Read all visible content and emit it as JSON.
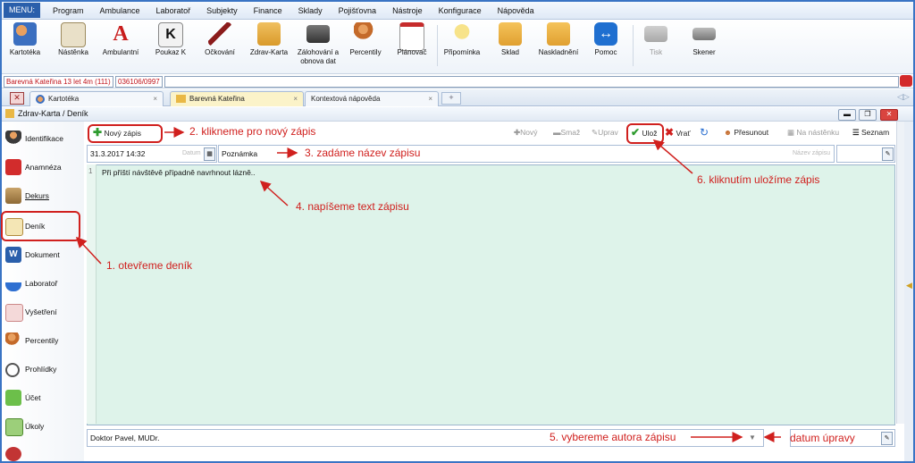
{
  "menu": {
    "label": "MENU:",
    "items": [
      "Program",
      "Ambulance",
      "Laboratoř",
      "Subjekty",
      "Finance",
      "Sklady",
      "Pojišťovna",
      "Nástroje",
      "Konfigurace",
      "Nápověda"
    ]
  },
  "toolbar": {
    "items": [
      {
        "label": "Kartotéka",
        "icon": "people-icon"
      },
      {
        "label": "Nástěnka",
        "icon": "clipboard-icon"
      },
      {
        "label": "Ambulantní",
        "icon": "letter-a-icon"
      },
      {
        "label": "Poukaz K",
        "icon": "letter-k-icon"
      },
      {
        "label": "Očkování",
        "icon": "syringe-icon"
      },
      {
        "label": "Zdrav-Karta",
        "icon": "health-card-icon"
      },
      {
        "label": "Zálohování a obnova dat",
        "icon": "backup-drive-icon"
      },
      {
        "label": "Percentily",
        "icon": "growth-chart-icon"
      },
      {
        "label": "Plánovač",
        "icon": "calendar-icon"
      },
      {
        "label": "Připomínka",
        "icon": "lightbulb-icon"
      },
      {
        "label": "Sklad",
        "icon": "box-icon"
      },
      {
        "label": "Naskladnění",
        "icon": "box-add-icon"
      },
      {
        "label": "Pomoc",
        "icon": "teamviewer-icon"
      },
      {
        "label": "Tisk",
        "icon": "printer-icon"
      },
      {
        "label": "Skener",
        "icon": "scanner-icon"
      }
    ]
  },
  "patient": {
    "name": "Barevná Kateřina 13 let 4m (111)",
    "birth_number": "036106/0997"
  },
  "tabs": [
    {
      "label": "Kartotéka"
    },
    {
      "label": "Barevná Kateřina"
    },
    {
      "label": "Kontextová nápověda"
    }
  ],
  "window": {
    "title": "Zdrav-Karta / Deník"
  },
  "sidebar": {
    "items": [
      {
        "label": "Identifikace"
      },
      {
        "label": "Anamnéza"
      },
      {
        "label": "Dekurs"
      },
      {
        "label": "Deník"
      },
      {
        "label": "Dokument"
      },
      {
        "label": "Laboratoř"
      },
      {
        "label": "Vyšetření"
      },
      {
        "label": "Percentily"
      },
      {
        "label": "Prohlídky"
      },
      {
        "label": "Účet"
      },
      {
        "label": "Úkoly"
      }
    ]
  },
  "content_toolbar": {
    "new_entry": "Nový zápis",
    "new": "Nový",
    "delete": "Smaž",
    "edit": "Uprav",
    "save": "Ulož",
    "revert": "Vrať",
    "move": "Přesunout",
    "on_board": "Na nástěnku",
    "list": "Seznam"
  },
  "fields": {
    "date_value": "31.3.2017 14:32",
    "date_placeholder": "Datum",
    "title_value": "Poznámka",
    "title_placeholder": "Název zápisu",
    "line_number": "1",
    "text": "Při příští návštěvě případně navrhnout lázně..",
    "author": "Doktor Pavel, MUDr."
  },
  "annotations": {
    "a1": "1. otevřeme deník",
    "a2": "2. klikneme pro nový zápis",
    "a3": "3. zadáme název zápisu",
    "a4": "4. napíšeme text zápisu",
    "a5": "5. vybereme autora zápisu",
    "a6": "6. kliknutím uložíme zápis",
    "a7": "datum úpravy"
  },
  "colors": {
    "annotation": "#d0201e",
    "accent": "#2a5fab",
    "editor_bg": "#def3ea"
  }
}
